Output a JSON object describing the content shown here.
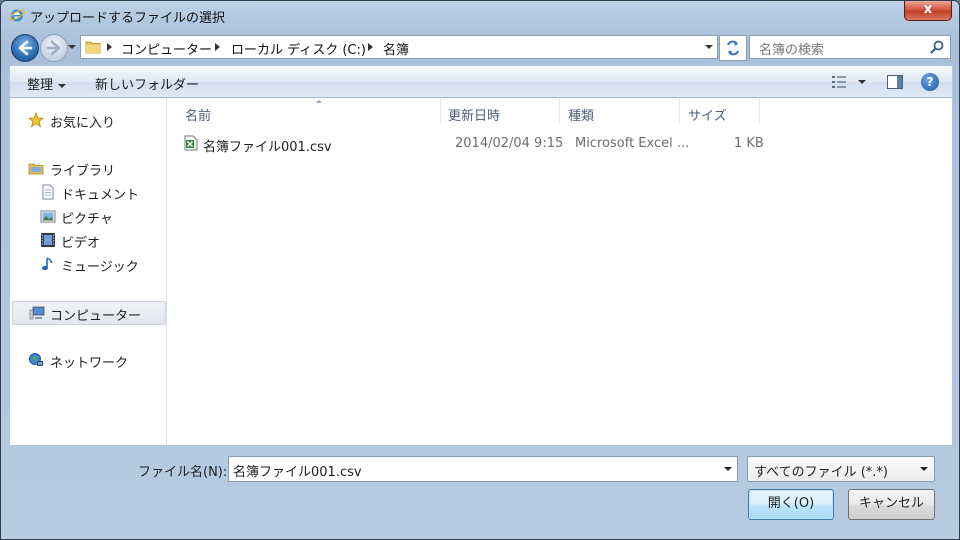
{
  "window": {
    "title": "アップロードするファイルの選択",
    "close_label": "x"
  },
  "address": {
    "segments": [
      "コンピューター",
      "ローカル ディスク (C:)",
      "名簿"
    ]
  },
  "search": {
    "placeholder": "名簿の検索"
  },
  "toolbar": {
    "organize_label": "整理",
    "new_folder_label": "新しいフォルダー",
    "help_label": "?"
  },
  "nav": {
    "items": [
      {
        "label": "お気に入り",
        "icon": "star-icon"
      },
      {
        "label": "ライブラリ",
        "icon": "library-icon"
      },
      {
        "label": "ドキュメント",
        "icon": "document-icon"
      },
      {
        "label": "ピクチャ",
        "icon": "picture-icon"
      },
      {
        "label": "ビデオ",
        "icon": "video-icon"
      },
      {
        "label": "ミュージック",
        "icon": "music-icon"
      },
      {
        "label": "コンピューター",
        "icon": "computer-icon",
        "selected": true
      },
      {
        "label": "ネットワーク",
        "icon": "network-icon"
      }
    ]
  },
  "columns": [
    "名前",
    "更新日時",
    "種類",
    "サイズ"
  ],
  "files": [
    {
      "name": "名簿ファイル001.csv",
      "modified": "2014/02/04 9:15",
      "type": "Microsoft Excel ...",
      "size": "1 KB",
      "icon": "excel-csv-icon"
    }
  ],
  "footer": {
    "filename_label": "ファイル名(N):",
    "filename_value": "名簿ファイル001.csv",
    "filter_value": "すべてのファイル (*.*)",
    "open_label": "開く(O)",
    "cancel_label": "キャンセル"
  }
}
